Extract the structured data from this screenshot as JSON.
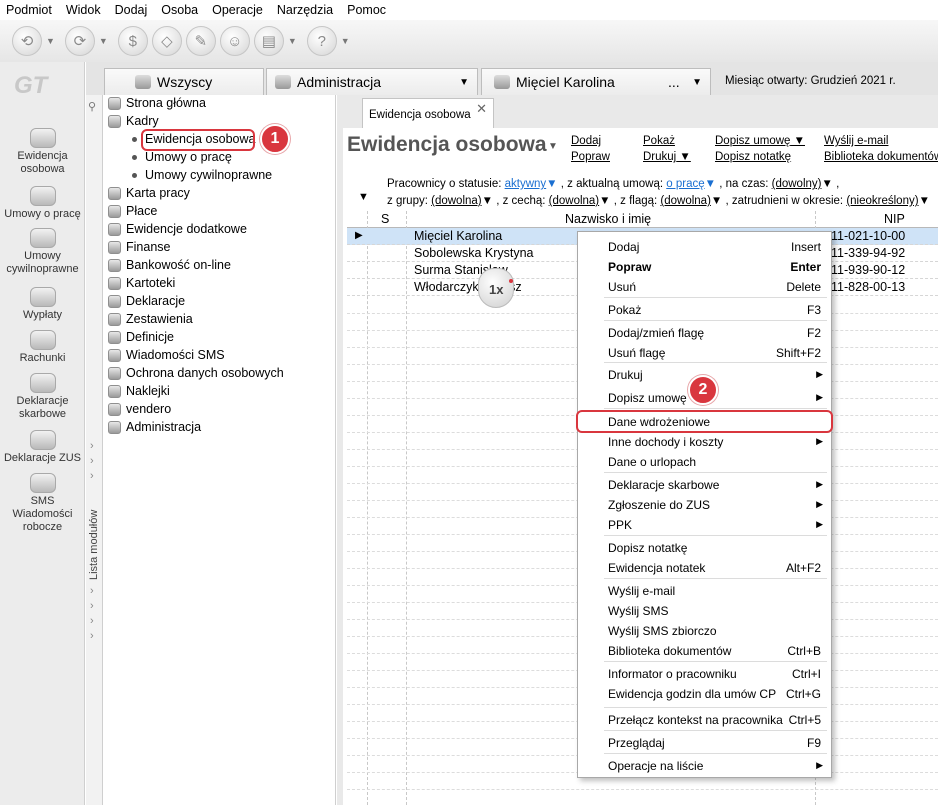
{
  "menubar": [
    "Podmiot",
    "Widok",
    "Dodaj",
    "Osoba",
    "Operacje",
    "Narzędzia",
    "Pomoc"
  ],
  "logo": "GT",
  "leftbar": [
    {
      "label": "Ewidencja osobowa",
      "icon": "people-icon"
    },
    {
      "label": "Umowy o pracę",
      "icon": "person-icon"
    },
    {
      "label": "Umowy cywilnoprawne",
      "icon": "contract-icon"
    },
    {
      "label": "Wypłaty",
      "icon": "payout-icon"
    },
    {
      "label": "Rachunki",
      "icon": "bill-icon"
    },
    {
      "label": "Deklaracje skarbowe",
      "icon": "tax-icon"
    },
    {
      "label": "Deklaracje ZUS",
      "icon": "zus-icon"
    },
    {
      "label": "SMS Wiadomości robocze",
      "icon": "sms-icon"
    }
  ],
  "strip_label": "Lista modułów",
  "tabs": {
    "wszyscy": "Wszyscy",
    "administracja": "Administracja",
    "person": "Mięciel Karolina",
    "person_more": "...",
    "month": "Miesiąc otwarty: Grudzień 2021 r."
  },
  "tree": {
    "items": [
      "Strona główna",
      "Kadry"
    ],
    "kadry_sub": [
      "Ewidencja osobowa",
      "Umowy o pracę",
      "Umowy cywilnoprawne"
    ],
    "rest": [
      "Karta pracy",
      "Płace",
      "Ewidencje dodatkowe",
      "Finanse",
      "Bankowość on-line",
      "Kartoteki",
      "Deklaracje",
      "Zestawienia",
      "Definicje",
      "Wiadomości SMS",
      "Ochrona danych osobowych",
      "Naklejki",
      "vendero",
      "Administracja"
    ]
  },
  "badges": {
    "one": "1",
    "two": "2"
  },
  "doc_tab": "Ewidencja osobowa",
  "page_title": "Ewidencja osobowa",
  "actions": {
    "dodaj": "Dodaj",
    "popraw": "Popraw",
    "pokaz": "Pokaż",
    "drukuj": "Drukuj",
    "dopisz_umowe": "Dopisz umowę",
    "dopisz_notatke": "Dopisz notatkę",
    "wyslij_email": "Wyślij e-mail",
    "biblioteka": "Biblioteka dokumentów"
  },
  "filters": {
    "line1_a": "Pracownicy o statusie:",
    "status": "aktywny",
    "line1_b": ", z aktualną umową:",
    "umowa": "o pracę",
    "line1_c": ", na czas:",
    "czas": "(dowolny)",
    "line2_a": "z grupy:",
    "grupa": "(dowolna)",
    "line2_b": ", z cechą:",
    "cecha": "(dowolna)",
    "line2_c": ", z flagą:",
    "flaga": "(dowolna)",
    "line2_d": ", zatrudnieni w okresie:",
    "okres": "(nieokreślony)"
  },
  "grid": {
    "headers": {
      "s": "S",
      "name": "Nazwisko i imię",
      "nip": "NIP"
    },
    "rows": [
      {
        "name": "Mięciel Karolina",
        "nip": "111-021-10-00"
      },
      {
        "name": "Sobolewska Krystyna",
        "nip": "111-339-94-92"
      },
      {
        "name": "Surma Stanisław",
        "nip": "111-939-90-12"
      },
      {
        "name": "Włodarczyk Łukasz",
        "nip": "111-828-00-13"
      }
    ]
  },
  "cursor_label": "1x",
  "context_menu": [
    {
      "label": "Dodaj",
      "shortcut": "Insert"
    },
    {
      "label": "Popraw",
      "shortcut": "Enter",
      "bold": true
    },
    {
      "label": "Usuń",
      "shortcut": "Delete"
    },
    {
      "label": "Pokaż",
      "shortcut": "F3"
    },
    {
      "label": "Dodaj/zmień flagę",
      "shortcut": "F2"
    },
    {
      "label": "Usuń flagę",
      "shortcut": "Shift+F2"
    },
    {
      "label": "Drukuj",
      "submenu": true
    },
    {
      "label": "Dopisz umowę",
      "submenu": true
    },
    {
      "label": "Dane wdrożeniowe"
    },
    {
      "label": "Inne dochody i koszty",
      "submenu": true
    },
    {
      "label": "Dane o urlopach"
    },
    {
      "label": "Deklaracje skarbowe",
      "submenu": true
    },
    {
      "label": "Zgłoszenie do ZUS",
      "submenu": true
    },
    {
      "label": "PPK",
      "submenu": true
    },
    {
      "label": "Dopisz notatkę"
    },
    {
      "label": "Ewidencja notatek",
      "shortcut": "Alt+F2"
    },
    {
      "label": "Wyślij e-mail"
    },
    {
      "label": "Wyślij SMS"
    },
    {
      "label": "Wyślij SMS zbiorczo"
    },
    {
      "label": "Biblioteka dokumentów",
      "shortcut": "Ctrl+B"
    },
    {
      "label": "Informator o pracowniku",
      "shortcut": "Ctrl+I"
    },
    {
      "label": "Ewidencja godzin dla umów CP",
      "shortcut": "Ctrl+G"
    },
    {
      "label": "Przełącz kontekst na pracownika",
      "shortcut": "Ctrl+5"
    },
    {
      "label": "Przeglądaj",
      "shortcut": "F9"
    },
    {
      "label": "Operacje na liście",
      "submenu": true
    }
  ],
  "colors": {
    "accent_red": "#d9363e",
    "selection": "#cfe3f7",
    "link_blue": "#1a6fd1"
  }
}
